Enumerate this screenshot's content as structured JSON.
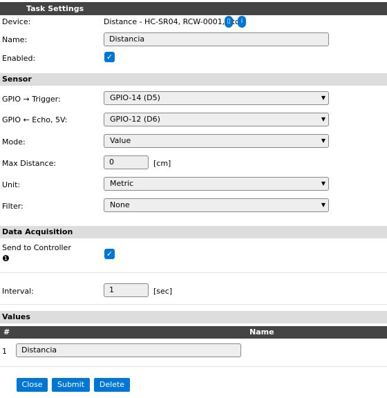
{
  "task_settings": {
    "title": "Task Settings",
    "device_label": "Device:",
    "device_value": "Distance - HC-SR04, RCW-0001, etc.",
    "name_label": "Name:",
    "name_value": "Distancia",
    "enabled_label": "Enabled:"
  },
  "sensor": {
    "title": "Sensor",
    "trigger_label": "GPIO → Trigger:",
    "trigger_value": "GPIO-14 (D5)",
    "echo_label": "GPIO ← Echo, 5V:",
    "echo_value": "GPIO-12 (D6)",
    "mode_label": "Mode:",
    "mode_value": "Value",
    "maxdist_label": "Max Distance:",
    "maxdist_value": "0",
    "maxdist_unit": "[cm]",
    "unit_label": "Unit:",
    "unit_value": "Metric",
    "filter_label": "Filter:",
    "filter_value": "None"
  },
  "data_acquisition": {
    "title": "Data Acquisition",
    "send_label": "Send to Controller",
    "send_index": "❶",
    "interval_label": "Interval:",
    "interval_value": "1",
    "interval_unit": "[sec]"
  },
  "values": {
    "title": "Values",
    "col_index": "#",
    "col_name": "Name",
    "rows": [
      {
        "index": "1",
        "name": "Distancia"
      }
    ]
  },
  "buttons": {
    "close": "Close",
    "submit": "Submit",
    "delete": "Delete"
  },
  "colors": {
    "accent": "#0077d6",
    "header_bg": "#444444",
    "section_bg": "#dddddd"
  }
}
